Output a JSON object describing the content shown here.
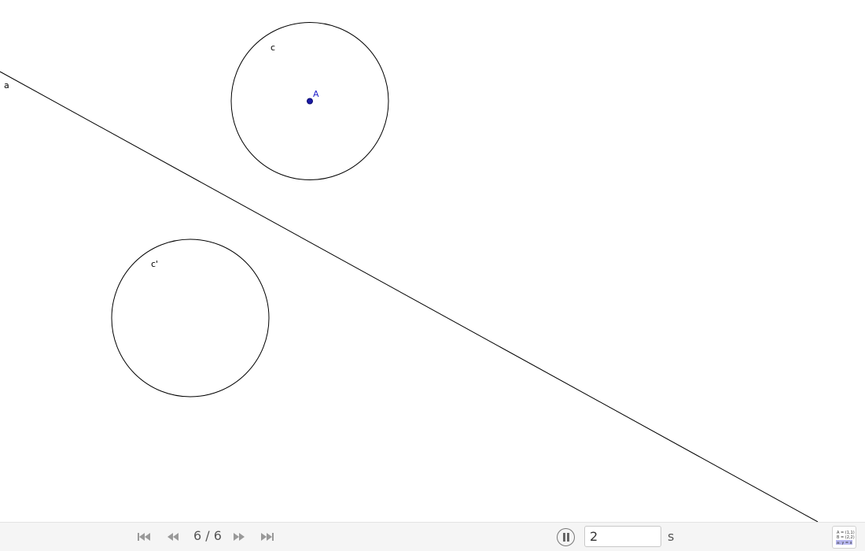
{
  "construction": {
    "line_label": "a",
    "circle_label": "c",
    "image_circle_label": "c'",
    "point_label": "A"
  },
  "navigation": {
    "step_counter": "6 / 6",
    "speed_value": "2",
    "speed_unit": "s",
    "icons": [
      "first-step-icon",
      "previous-step-icon",
      "next-step-icon",
      "last-step-icon",
      "pause-icon",
      "algebra-view-icon"
    ]
  },
  "algebra_preview": {
    "line1": "A = (1,1)",
    "line2": "B = (2,2)",
    "line3": "a: y = x"
  },
  "colors": {
    "point": "#1a1aa6",
    "point_label": "#2222cc",
    "stroke": "#000000",
    "navbar_bg": "#f5f5f5",
    "algebra_highlight": "#b8b8f0"
  }
}
